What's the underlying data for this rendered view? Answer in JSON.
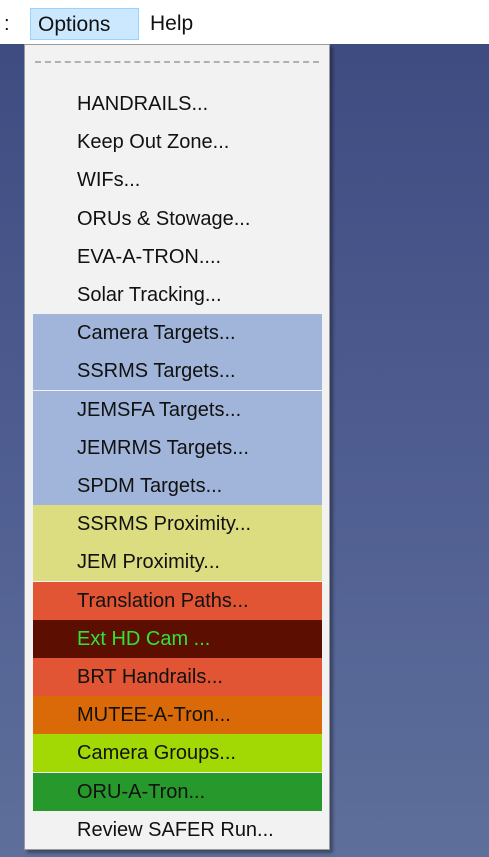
{
  "menubar": {
    "overflow_glyph": ":",
    "items": [
      {
        "label": "Options",
        "active": true
      },
      {
        "label": "Help",
        "active": false
      }
    ]
  },
  "dropdown": {
    "tearoff": "- - - - - - - - - - - -",
    "items": [
      {
        "label": "HANDRAILS...",
        "bg": "#f2f2f2",
        "fg": "#111111"
      },
      {
        "label": "Keep Out Zone...",
        "bg": "#f2f2f2",
        "fg": "#111111"
      },
      {
        "label": "WIFs...",
        "bg": "#f2f2f2",
        "fg": "#111111"
      },
      {
        "label": "ORUs & Stowage...",
        "bg": "#f2f2f2",
        "fg": "#111111"
      },
      {
        "label": "EVA-A-TRON....",
        "bg": "#f2f2f2",
        "fg": "#111111"
      },
      {
        "label": "Solar Tracking...",
        "bg": "#f2f2f2",
        "fg": "#111111"
      },
      {
        "label": "Camera Targets...",
        "bg": "#a0b5d9",
        "fg": "#111111"
      },
      {
        "label": "SSRMS Targets...",
        "bg": "#a0b5d9",
        "fg": "#111111"
      },
      {
        "label": "JEMSFA Targets...",
        "bg": "#a0b5d9",
        "fg": "#111111"
      },
      {
        "label": "JEMRMS Targets...",
        "bg": "#a0b5d9",
        "fg": "#111111"
      },
      {
        "label": "SPDM Targets...",
        "bg": "#a0b5d9",
        "fg": "#111111"
      },
      {
        "label": "SSRMS Proximity...",
        "bg": "#dcdc80",
        "fg": "#111111"
      },
      {
        "label": "JEM Proximity...",
        "bg": "#dcdc80",
        "fg": "#111111"
      },
      {
        "label": "Translation Paths...",
        "bg": "#e15534",
        "fg": "#111111"
      },
      {
        "label": "Ext HD Cam ...",
        "bg": "#5c0e00",
        "fg": "#2ee62e"
      },
      {
        "label": "BRT Handrails...",
        "bg": "#e15534",
        "fg": "#111111"
      },
      {
        "label": "MUTEE-A-Tron...",
        "bg": "#d96a07",
        "fg": "#111111"
      },
      {
        "label": "Camera Groups...",
        "bg": "#a2d804",
        "fg": "#111111"
      },
      {
        "label": "ORU-A-Tron...",
        "bg": "#27992c",
        "fg": "#111111"
      },
      {
        "label": "Review SAFER Run...",
        "bg": "#f2f2f2",
        "fg": "#111111"
      }
    ]
  }
}
